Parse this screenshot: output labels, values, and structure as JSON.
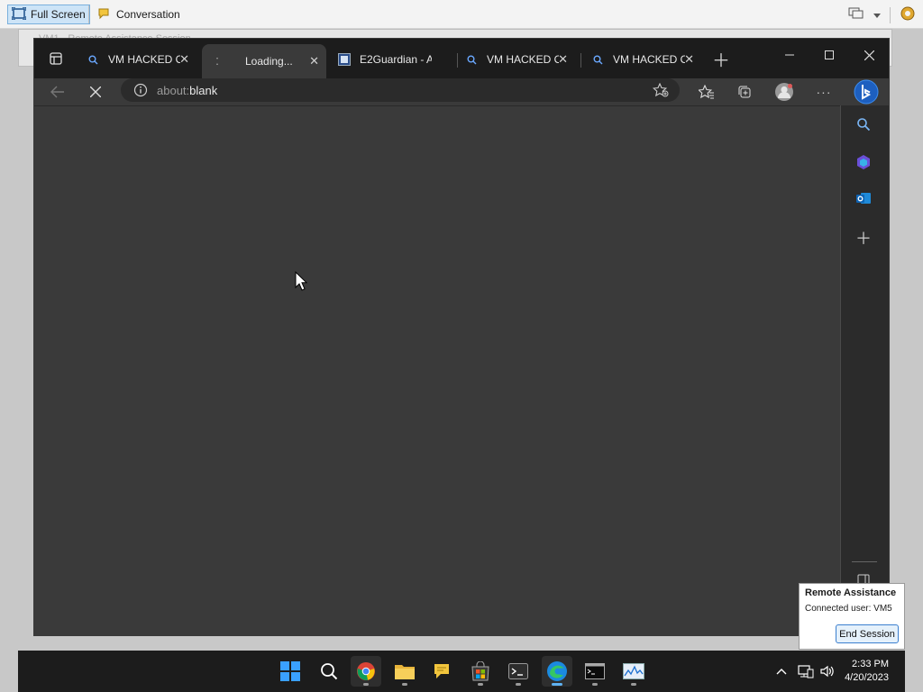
{
  "ra_toolbar": {
    "full_screen_label": "Full Screen",
    "conversation_label": "Conversation"
  },
  "behind_window": {
    "title": "VM1 - Remote Assistance Session"
  },
  "browser": {
    "tabs": [
      {
        "title": "VM HACKED O",
        "favicon": "search-icon",
        "active": false
      },
      {
        "title": "Loading...",
        "favicon": "loading-icon",
        "active": true
      },
      {
        "title": "E2Guardian - A",
        "favicon": "page-icon",
        "active": false
      },
      {
        "title": "VM HACKED O",
        "favicon": "search-icon",
        "active": false
      },
      {
        "title": "VM HACKED O",
        "favicon": "search-icon",
        "active": false
      }
    ],
    "address": {
      "prefix": "about:",
      "path": "blank"
    }
  },
  "taskbar": {
    "apps": [
      "start",
      "search",
      "chrome",
      "file-explorer",
      "feedback",
      "store",
      "terminal",
      "edge",
      "cmd",
      "resource-monitor"
    ],
    "clock_time": "2:33 PM",
    "clock_date": "4/20/2023"
  },
  "ra_popup": {
    "title": "Remote Assistance",
    "connected_label": "Connected user:",
    "connected_user": "VM5",
    "end_session_label": "End Session"
  },
  "colors": {
    "content_bg": "#3a3a3a",
    "tabbar_bg": "#1c1c1c",
    "accent": "#5fb2f2"
  }
}
